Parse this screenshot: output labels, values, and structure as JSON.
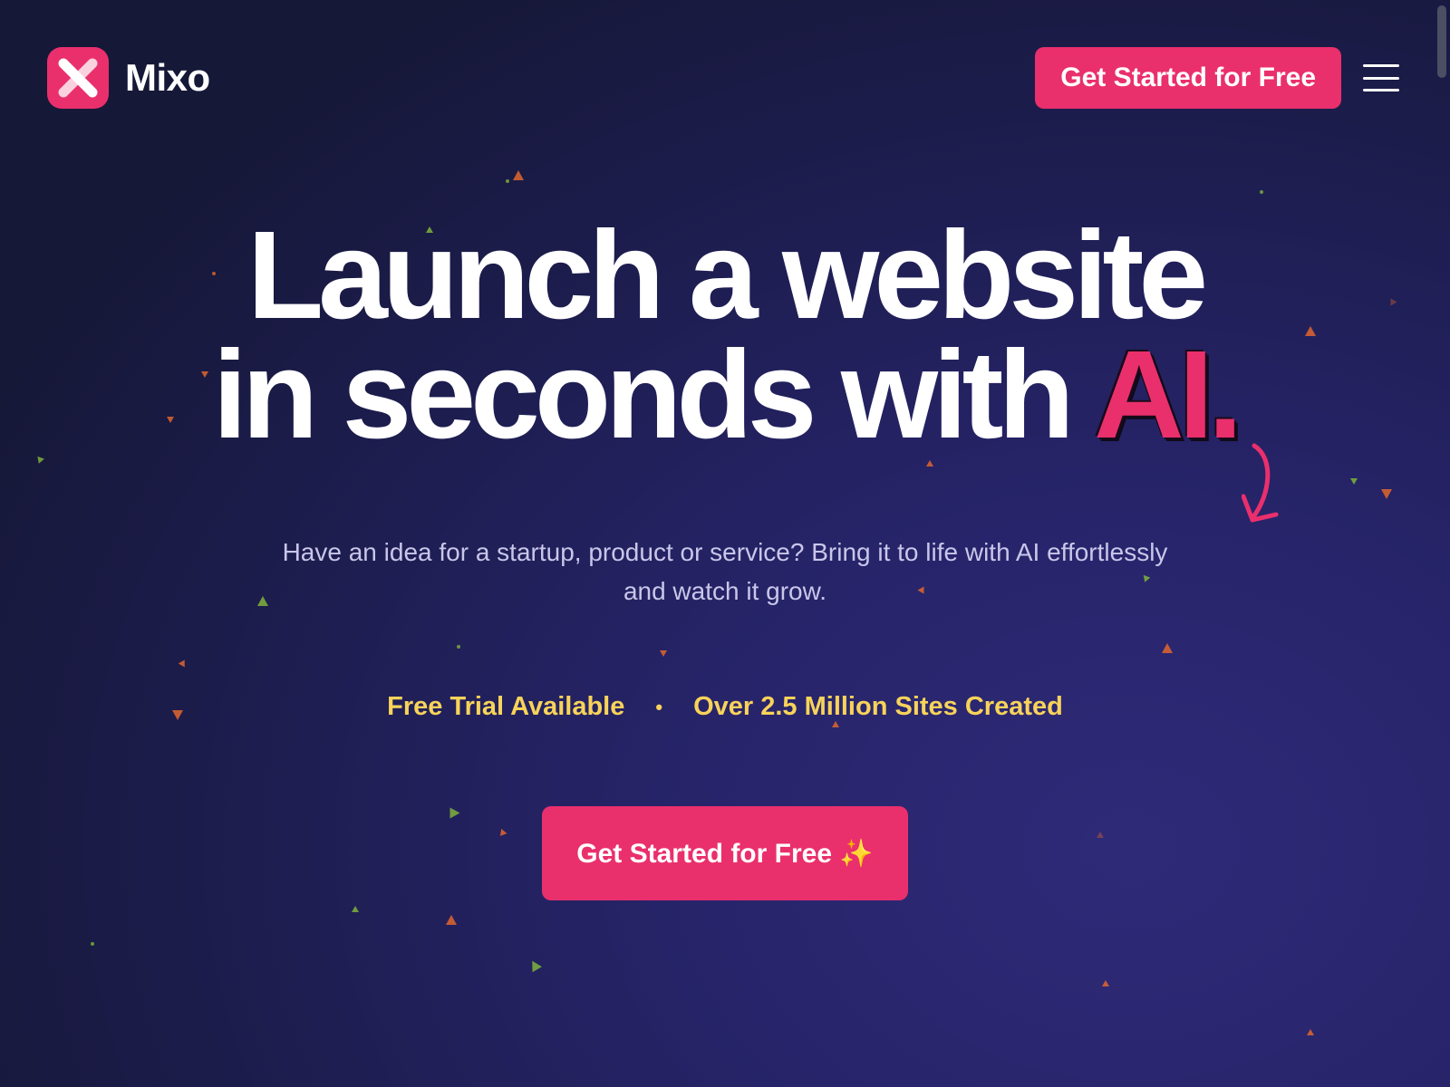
{
  "header": {
    "brand_name": "Mixo",
    "cta_label": "Get Started for Free"
  },
  "hero": {
    "title_line1": "Launch a website",
    "title_line2_prefix": "in seconds with ",
    "title_accent": "AI.",
    "subtitle": "Have an idea for a startup, product or service? Bring it to life with AI effortlessly and watch it grow.",
    "feature_1": "Free Trial Available",
    "feature_separator": "•",
    "feature_2": "Over 2.5 Million Sites Created",
    "cta_label": "Get Started for Free ✨"
  },
  "colors": {
    "brand_pink": "#ea2f6d",
    "highlight_yellow": "#f8d35a",
    "background": "#24235f"
  },
  "icons": {
    "logo": "x-logo-icon",
    "menu": "hamburger-menu-icon",
    "arrow": "curved-arrow-icon"
  }
}
